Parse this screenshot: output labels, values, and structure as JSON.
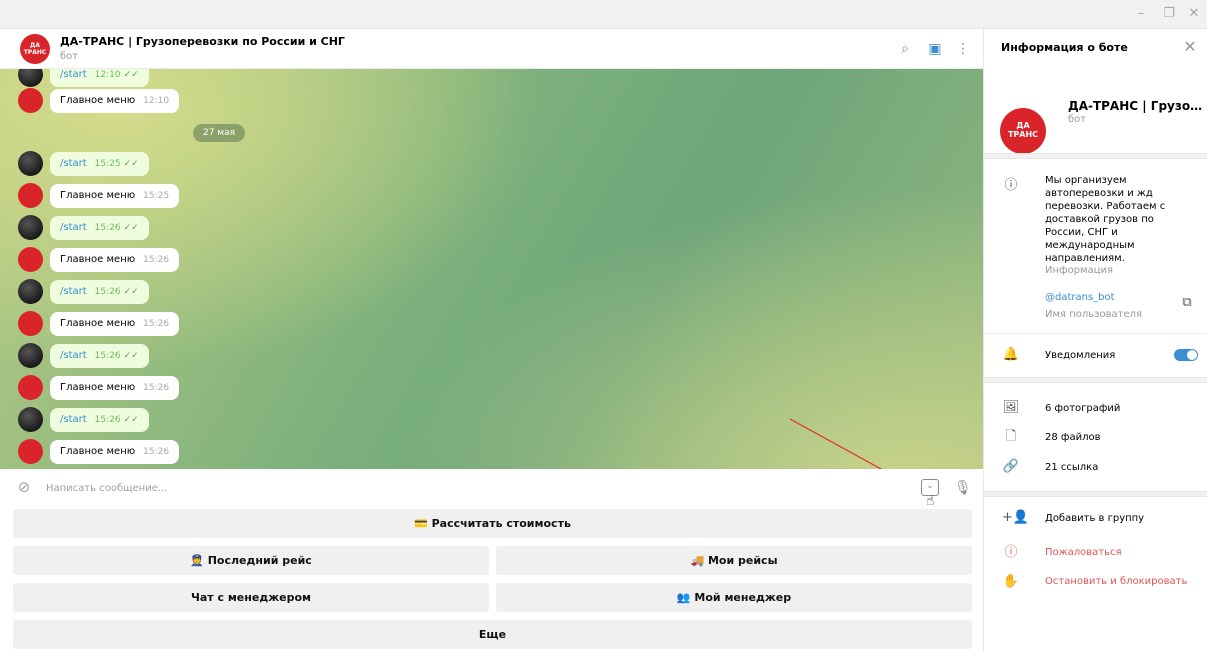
{
  "window": {
    "min_icon": "minimize-icon",
    "restore_icon": "restore-icon",
    "close_icon": "close-icon",
    "min": "–",
    "restore": "❐",
    "close": "✕"
  },
  "header": {
    "avatar_text": "ДА ТРАНС",
    "title": "ДА-ТРАНС | Грузоперевозки по России и СНГ",
    "status": "бот",
    "search_glyph": "⌕",
    "panel_glyph": "▣",
    "more_glyph": "⋮"
  },
  "messages": [
    {
      "from": "user",
      "text": "/start",
      "time": "12:10",
      "read": true
    },
    {
      "from": "bot",
      "text": "Главное меню",
      "time": "12:10"
    },
    {
      "from": "user",
      "text": "/start",
      "time": "15:25",
      "read": true
    },
    {
      "from": "bot",
      "text": "Главное меню",
      "time": "15:25"
    },
    {
      "from": "user",
      "text": "/start",
      "time": "15:26",
      "read": true
    },
    {
      "from": "bot",
      "text": "Главное меню",
      "time": "15:26"
    },
    {
      "from": "user",
      "text": "/start",
      "time": "15:26",
      "read": true
    },
    {
      "from": "bot",
      "text": "Главное меню",
      "time": "15:26"
    },
    {
      "from": "user",
      "text": "/start",
      "time": "15:26",
      "read": true
    },
    {
      "from": "bot",
      "text": "Главное меню",
      "time": "15:26"
    },
    {
      "from": "user",
      "text": "/start",
      "time": "15:26",
      "read": true
    },
    {
      "from": "bot",
      "text": "Главное меню",
      "time": "15:26"
    }
  ],
  "date_chip": "27 мая",
  "composer": {
    "placeholder": "Написать сообщение...",
    "attach_glyph": "⊘",
    "keyboard_glyph": "⌄",
    "mic_glyph": "🎙",
    "cursor_glyph": "☝"
  },
  "keyboard": {
    "row1": [
      "💳 Рассчитать стоимость"
    ],
    "row2": [
      "👮 Последний рейс",
      "🚚 Мои рейсы"
    ],
    "row3": [
      "Чат с менеджером",
      "👥 Мой менеджер"
    ],
    "row4": [
      "Еще"
    ]
  },
  "side": {
    "title": "Информация о боте",
    "close_glyph": "✕",
    "avatar_text": "ДА ТРАНС",
    "name": "ДА-ТРАНС | Грузоперевозки по России и СНГ",
    "sub": "бот",
    "info_text": "Мы организуем автоперевозки и жд перевозки. Работаем с доставкой грузов по России, СНГ и международным направлениям.",
    "info_label": "Информация",
    "username": "@datrans_bot",
    "username_label": "Имя пользователя",
    "notifications": "Уведомления",
    "notifications_on": true,
    "photos": "6 фотографий",
    "files": "28 файлов",
    "links": "21 ссылка",
    "add_group": "Добавить в группу",
    "report": "Пожаловаться",
    "block": "Остановить и блокировать",
    "glyphs": {
      "info": "ⓘ",
      "bell": "🔔",
      "photo": "🖼",
      "file": "🗋",
      "link": "🔗",
      "add": "+👤",
      "report": "ⓘ",
      "block": "✋",
      "copy": "⧉"
    }
  },
  "colors": {
    "accent": "#3a8ed1",
    "brand": "#d9242a",
    "danger": "#e05454",
    "bubble_out": "#effdde"
  }
}
